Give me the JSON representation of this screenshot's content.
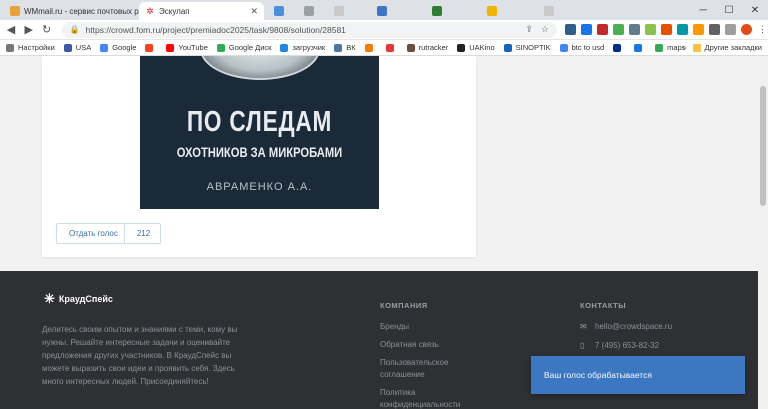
{
  "browser": {
    "tabs": [
      {
        "title": "WMmail.ru - сервис почтовых ра",
        "icon": "wmmail-icon",
        "active": false
      },
      {
        "title": "Эскулап",
        "icon": "asclepius-icon",
        "active": true
      }
    ],
    "url": "https://crowd.fom.ru/project/premiadoc2025/task/9808/solution/28581",
    "bookmarks": [
      {
        "label": "Настройки",
        "icon": "gear-icon"
      },
      {
        "label": "USA",
        "icon": "flag-icon"
      },
      {
        "label": "Google",
        "icon": "google-icon"
      },
      {
        "label": "",
        "icon": "yandex-icon"
      },
      {
        "label": "YouTube",
        "icon": "youtube-icon"
      },
      {
        "label": "Google Диск",
        "icon": "drive-icon"
      },
      {
        "label": "загрузчик",
        "icon": "download-icon"
      },
      {
        "label": "ВК",
        "icon": "vk-icon"
      },
      {
        "label": "",
        "icon": "bookmark-icon"
      },
      {
        "label": "",
        "icon": "feed-icon"
      },
      {
        "label": "rutracker",
        "icon": "rutracker-icon"
      },
      {
        "label": "UAKino",
        "icon": "uakino-icon"
      },
      {
        "label": "SINOPTIK",
        "icon": "sinoptik-icon"
      },
      {
        "label": "btc to usd",
        "icon": "google-icon"
      },
      {
        "label": "",
        "icon": "paypal-icon"
      },
      {
        "label": "",
        "icon": "translate-icon"
      },
      {
        "label": "maps",
        "icon": "maps-icon"
      }
    ],
    "other_bookmarks": "Другие закладки"
  },
  "book": {
    "title_line1": "ПО СЛЕДАМ",
    "title_line2": "ОХОТНИКОВ ЗА МИКРОБАМИ",
    "author": "АВРАМЕНКО А.А."
  },
  "vote": {
    "label": "Отдать голос",
    "count": "212"
  },
  "footer": {
    "logo": "КраудСпейс",
    "about": "Делитесь своим опытом и знаниями с теми, кому вы нужны. Решайте интересные задачи и оценивайте предложения других участников. В КраудСпейс вы можете выразить свои идеи и проявить себя. Здесь много интересных людей. Присоединяйтесь!",
    "company_heading": "КОМПАНИЯ",
    "company_links": [
      "Бренды",
      "Обратная связь",
      "Пользовательское соглашение",
      "Политика конфиденциальности"
    ],
    "contacts_heading": "КОНТАКТЫ",
    "email": "hello@crowdspace.ru",
    "phone": "7 (495) 653-82-32"
  },
  "toast": {
    "message": "Ваш голос обрабатывается"
  },
  "colors": {
    "footer_bg": "#2f3034",
    "accent": "#3d7bc7",
    "book_cover": "#1b2a38"
  }
}
